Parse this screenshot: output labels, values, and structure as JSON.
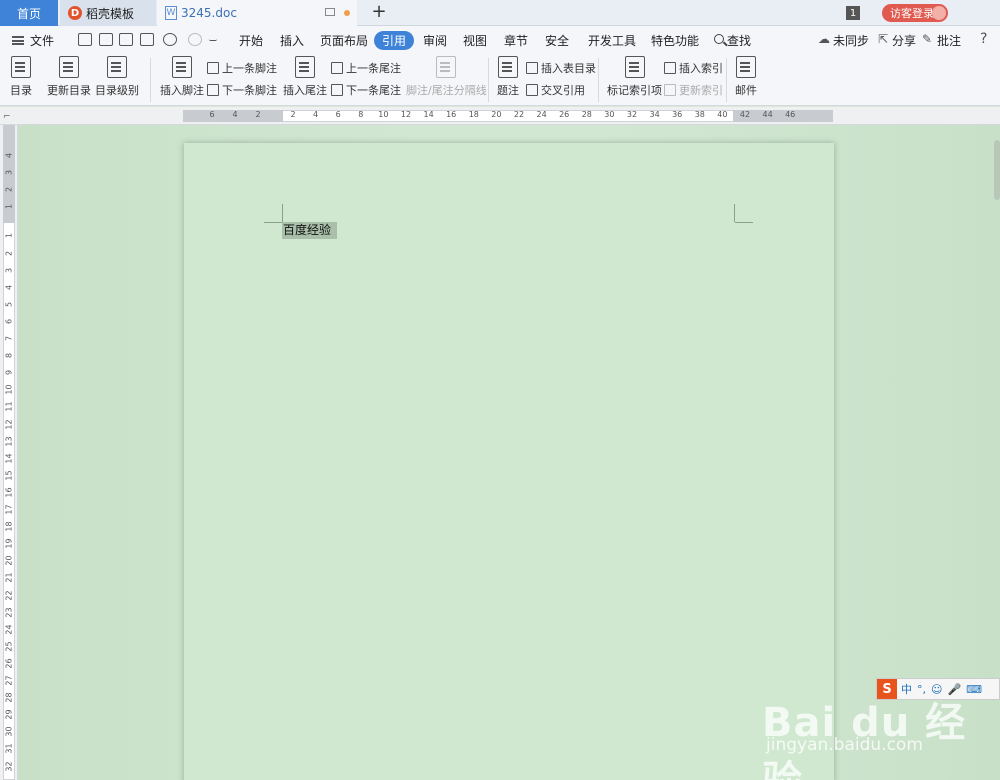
{
  "tabs": {
    "home": "首页",
    "template": "稻壳模板",
    "template_logo": "D",
    "doc": "3245.doc",
    "doc_logo": "W",
    "new_tab": "+",
    "count": "1",
    "login": "访客登录"
  },
  "menu": {
    "file": "文件",
    "items": [
      "开始",
      "插入",
      "页面布局",
      "引用",
      "审阅",
      "视图",
      "章节",
      "安全",
      "开发工具",
      "特色功能"
    ],
    "search": "查找",
    "sync": "未同步",
    "share": "分享",
    "comment": "批注",
    "help": "?"
  },
  "ribbon": {
    "toc": "目录",
    "update_toc": "更新目录",
    "toc_level": "目录级别",
    "insert_footnote": "插入脚注",
    "prev_footnote": "上一条脚注",
    "next_footnote": "下一条脚注",
    "insert_endnote": "插入尾注",
    "prev_endnote": "上一条尾注",
    "next_endnote": "下一条尾注",
    "separator": "脚注/尾注分隔线",
    "caption": "题注",
    "insert_table_of_figures": "插入表目录",
    "cross_ref": "交叉引用",
    "mark_index": "标记索引项",
    "insert_index": "插入索引",
    "update_index": "更新索引",
    "mail": "邮件"
  },
  "ruler": {
    "h_ticks": [
      "6",
      "4",
      "2",
      "2",
      "4",
      "6",
      "8",
      "10",
      "12",
      "14",
      "16",
      "18",
      "20",
      "22",
      "24",
      "26",
      "28",
      "30",
      "32",
      "34",
      "36",
      "38",
      "40",
      "42",
      "44",
      "46"
    ],
    "v_ticks": [
      "4",
      "3",
      "2",
      "1",
      "1",
      "2",
      "3",
      "4",
      "5",
      "6",
      "7",
      "8",
      "9",
      "10",
      "11",
      "12",
      "13",
      "14",
      "15",
      "16",
      "17",
      "18",
      "19",
      "20",
      "21",
      "22",
      "23",
      "24",
      "25",
      "26",
      "27",
      "28",
      "29",
      "30",
      "31",
      "32"
    ]
  },
  "document": {
    "text": "百度经验"
  },
  "ime": {
    "logo": "S",
    "mode": "中",
    "punct": "°,"
  },
  "watermark": {
    "logo": "Bai du 经验",
    "url": "jingyan.baidu.com"
  }
}
